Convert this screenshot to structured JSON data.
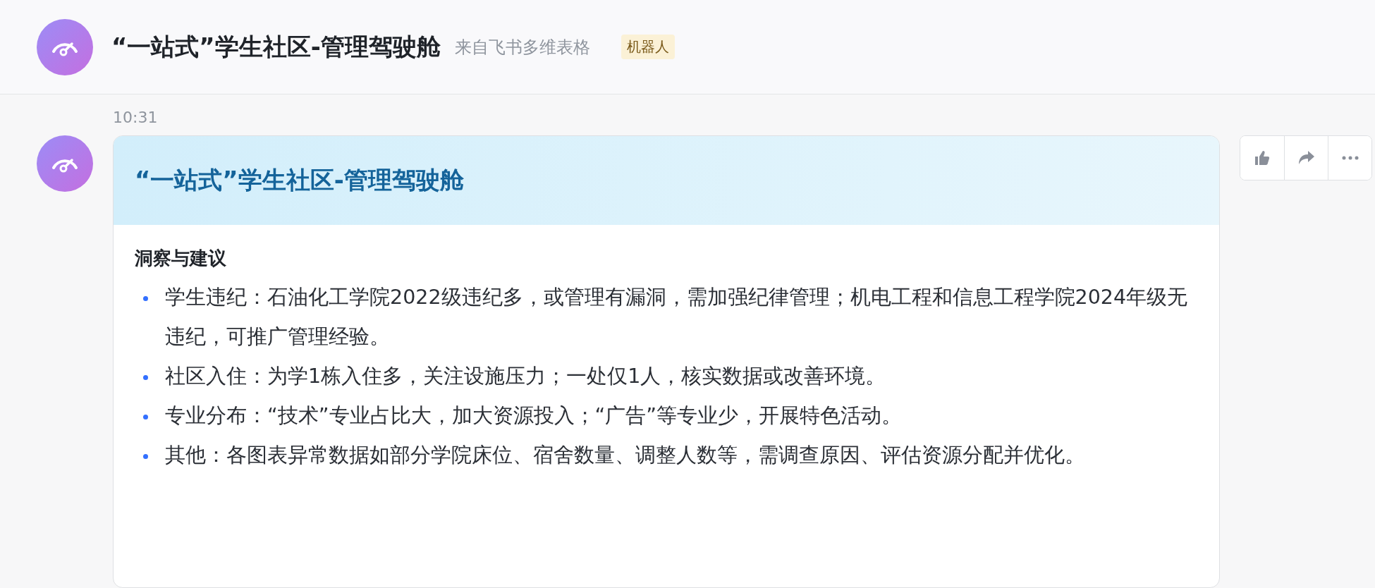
{
  "header": {
    "title": "“一站式”学生社区-管理驾驶舱",
    "source": "来自飞书多维表格",
    "badge": "机器人"
  },
  "message": {
    "time": "10:31",
    "card": {
      "title": "“一站式”学生社区-管理驾驶舱",
      "section_title": "洞察与建议",
      "items": [
        "学生违纪：石油化工学院2022级违纪多，或管理有漏洞，需加强纪律管理；机电工程和信息工程学院2024年级无违纪，可推广管理经验。",
        "社区入住：为学1栋入住多，关注设施压力；一处仅1人，核实数据或改善环境。",
        "专业分布：“技术”专业占比大，加大资源投入；“广告”等专业少，开展特色活动。",
        "其他：各图表异常数据如部分学院床位、宿舍数量、调整人数等，需调查原因、评估资源分配并优化。"
      ]
    }
  }
}
